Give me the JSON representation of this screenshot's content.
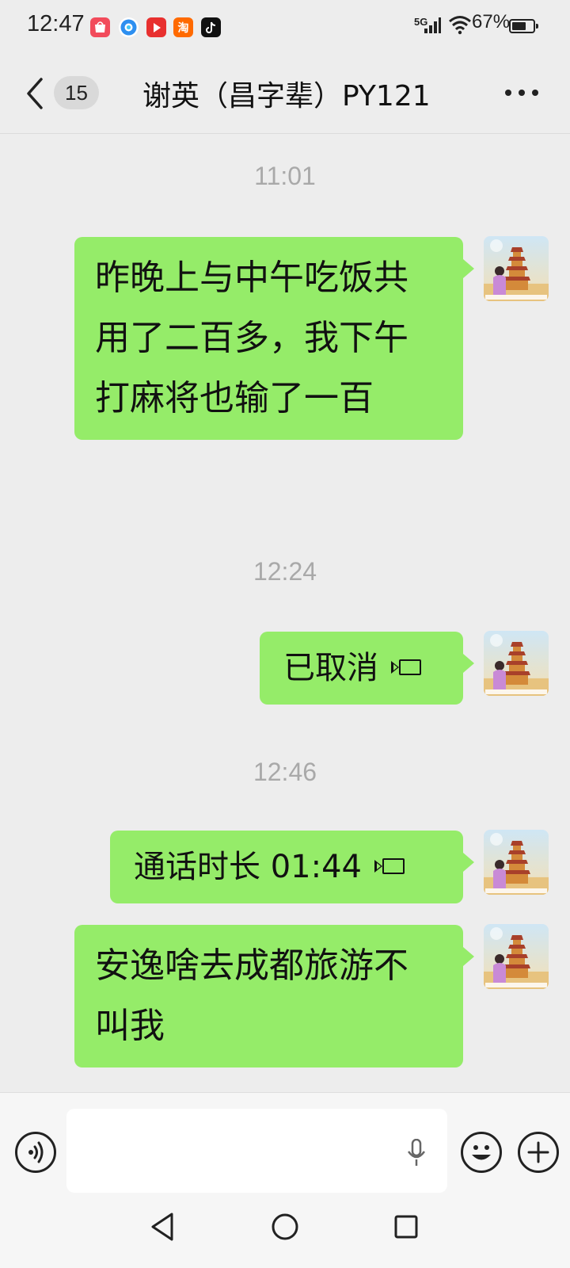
{
  "status_bar": {
    "time": "12:47",
    "network": "5G",
    "battery": "67%",
    "battery_level": 0.67,
    "app_icons": [
      "shopping-icon",
      "browser-icon",
      "video-icon",
      "taobao-icon",
      "tiktok-icon"
    ],
    "taobao_label": "淘"
  },
  "header": {
    "unread_count": "15",
    "title": "谢英（昌字辈）PY121"
  },
  "messages": [
    {
      "time": "11:01",
      "text": "昨晚上与中午吃饭共用了二百多，我下午打麻将也输了一百"
    },
    {
      "time": "12:24",
      "text": "已取消"
    },
    {
      "time": "12:46",
      "text": "通话时长 01:44"
    },
    {
      "text": "安逸啥去成都旅游不叫我"
    }
  ],
  "colors": {
    "bubble": "#95ec69",
    "background": "#ededed"
  }
}
